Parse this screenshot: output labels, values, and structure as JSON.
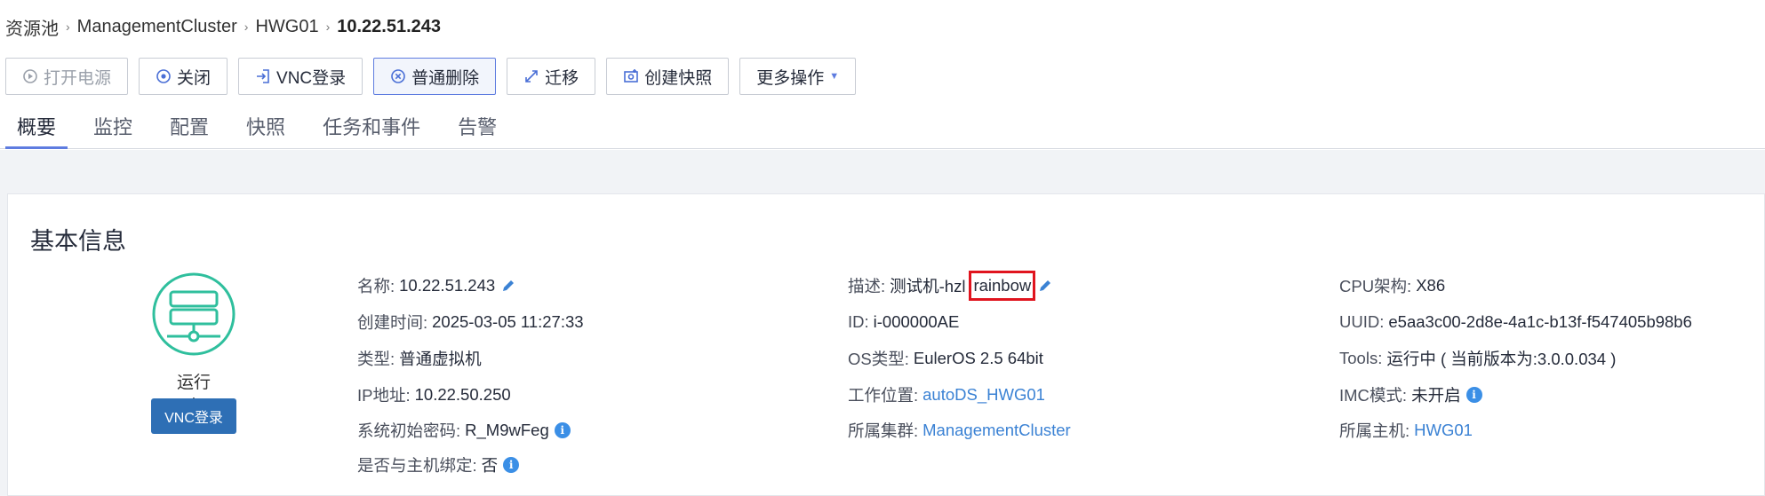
{
  "breadcrumb": {
    "items": [
      "资源池",
      "ManagementCluster",
      "HWG01"
    ],
    "current": "10.22.51.243"
  },
  "toolbar": {
    "power_on": "打开电源",
    "shutdown": "关闭",
    "vnc_login": "VNC登录",
    "normal_delete": "普通删除",
    "migrate": "迁移",
    "create_snapshot": "创建快照",
    "more_actions": "更多操作"
  },
  "tabs": [
    "概要",
    "监控",
    "配置",
    "快照",
    "任务和事件",
    "告警"
  ],
  "basic_info": {
    "title": "基本信息",
    "status": "运行中",
    "vnc_button": "VNC登录",
    "name_label": "名称:",
    "name_value": "10.22.51.243",
    "created_label": "创建时间:",
    "created_value": "2025-03-05 11:27:33",
    "type_label": "类型:",
    "type_value": "普通虚拟机",
    "ip_label": "IP地址:",
    "ip_value": "10.22.50.250",
    "password_label": "系统初始密码:",
    "password_value": "R_M9wFeg",
    "bind_label": "是否与主机绑定:",
    "bind_value": "否",
    "desc_label": "描述:",
    "desc_value": "测试机-hzl",
    "desc_highlight": "rainbow",
    "id_label": "ID:",
    "id_value": "i-000000AE",
    "os_label": "OS类型:",
    "os_value": "EulerOS 2.5 64bit",
    "location_label": "工作位置:",
    "location_value": "autoDS_HWG01",
    "cluster_label": "所属集群:",
    "cluster_value": "ManagementCluster",
    "cpu_label": "CPU架构:",
    "cpu_value": "X86",
    "uuid_label": "UUID:",
    "uuid_value": "e5aa3c00-2d8e-4a1c-b13f-f547405b98b6",
    "tools_label": "Tools:",
    "tools_value": "运行中 ( 当前版本为:3.0.0.034 )",
    "imc_label": "IMC模式:",
    "imc_value": "未开启",
    "host_label": "所属主机:",
    "host_value": "HWG01"
  },
  "colors": {
    "accent": "#5e7ce0",
    "link": "#3b82d4",
    "status_green": "#2fbf9d",
    "vnc_button": "#2e6fb5",
    "highlight_border": "#e0141e"
  }
}
